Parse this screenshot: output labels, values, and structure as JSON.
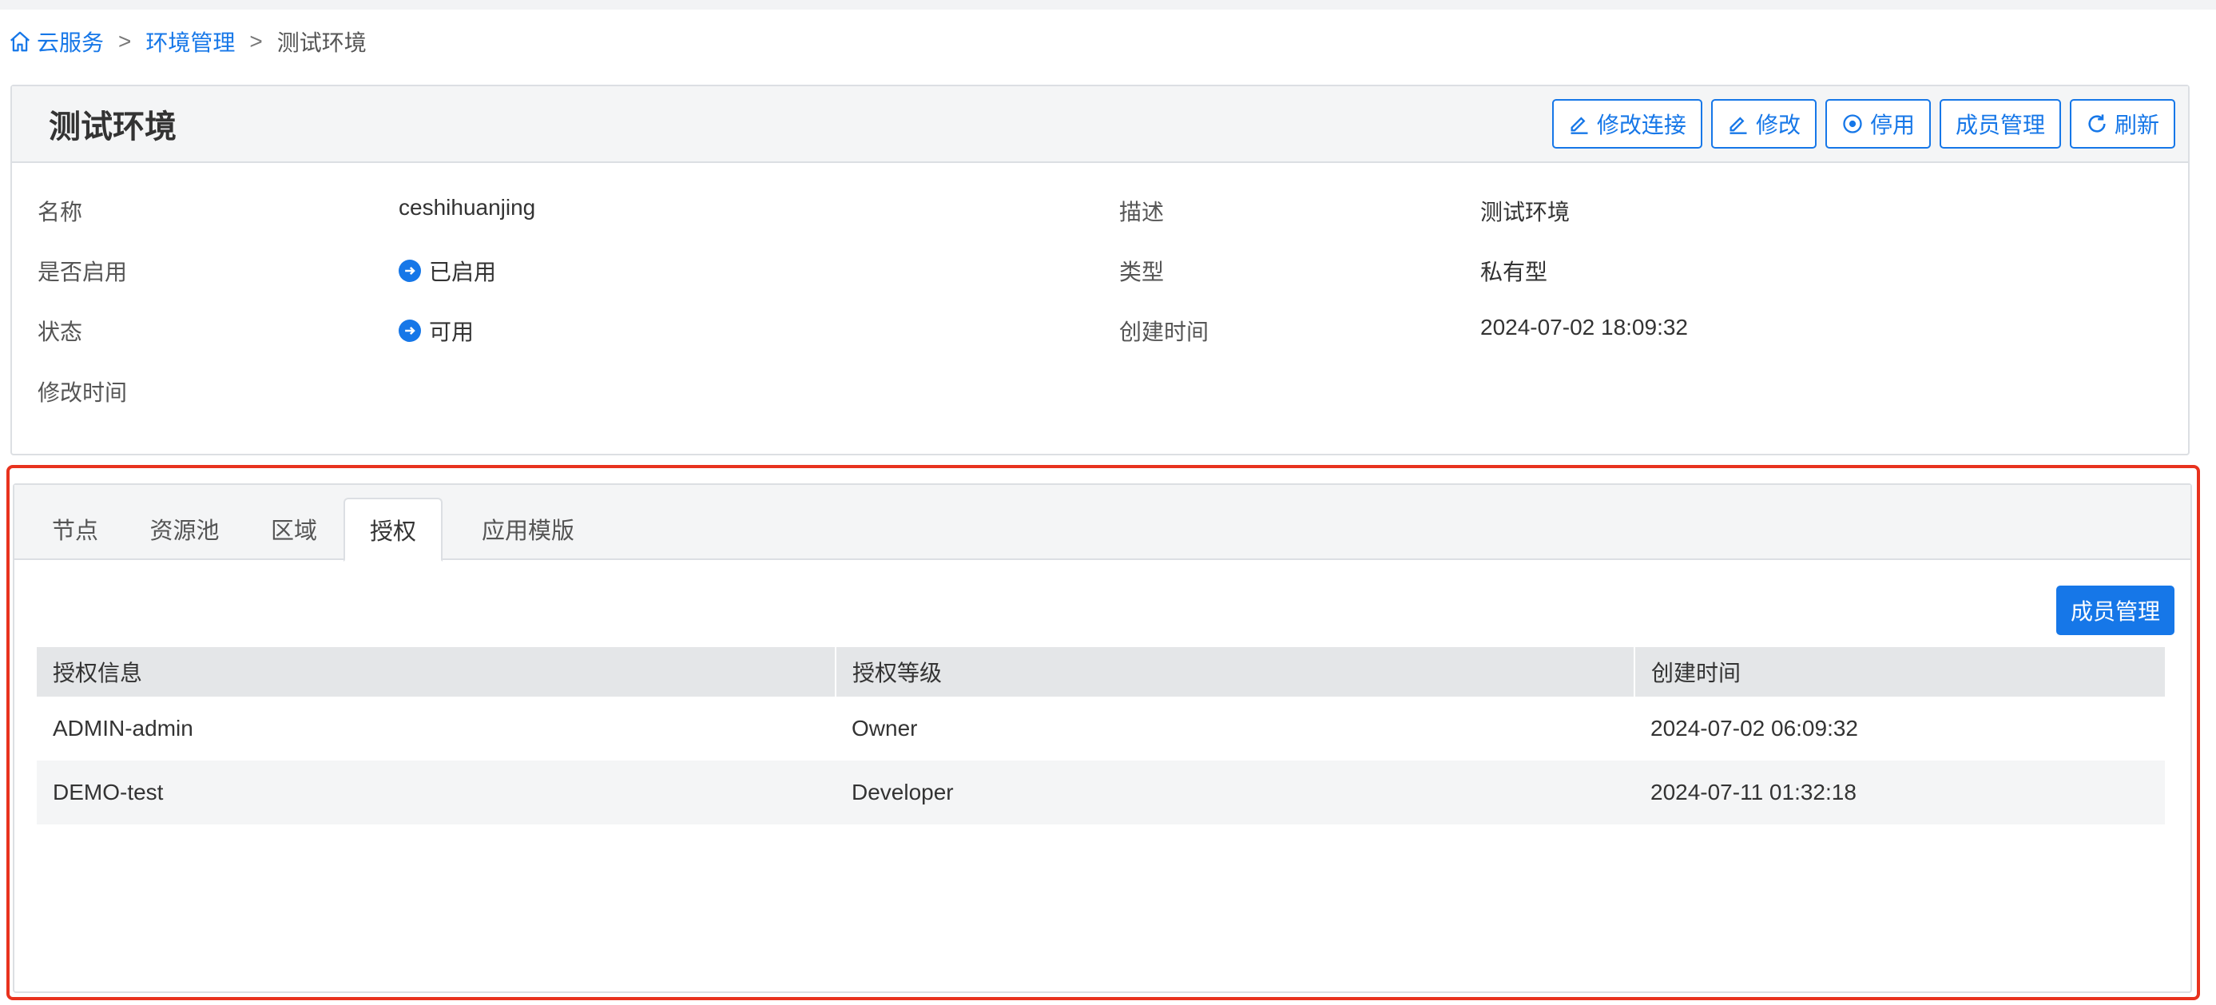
{
  "breadcrumb": {
    "items": [
      "云服务",
      "环境管理"
    ],
    "separator": ">",
    "current": "测试环境"
  },
  "header": {
    "title": "测试环境",
    "buttons": {
      "edit_connection": "修改连接",
      "edit": "修改",
      "disable": "停用",
      "members": "成员管理",
      "refresh": "刷新"
    }
  },
  "info": {
    "name_label": "名称",
    "name_value": "ceshihuanjing",
    "enabled_label": "是否启用",
    "enabled_value": "已启用",
    "status_label": "状态",
    "status_value": "可用",
    "modified_label": "修改时间",
    "modified_value": "",
    "desc_label": "描述",
    "desc_value": "测试环境",
    "type_label": "类型",
    "type_value": "私有型",
    "created_label": "创建时间",
    "created_value": "2024-07-02 18:09:32"
  },
  "tabs": [
    "节点",
    "资源池",
    "区域",
    "授权",
    "应用模版"
  ],
  "active_tab": "授权",
  "auth": {
    "member_button": "成员管理",
    "columns": [
      "授权信息",
      "授权等级",
      "创建时间"
    ],
    "rows": [
      [
        "ADMIN-admin",
        "Owner",
        "2024-07-02 06:09:32"
      ],
      [
        "DEMO-test",
        "Developer",
        "2024-07-11 01:32:18"
      ]
    ]
  },
  "colors": {
    "accent": "#1677e8",
    "highlight_border": "#e8321e"
  }
}
